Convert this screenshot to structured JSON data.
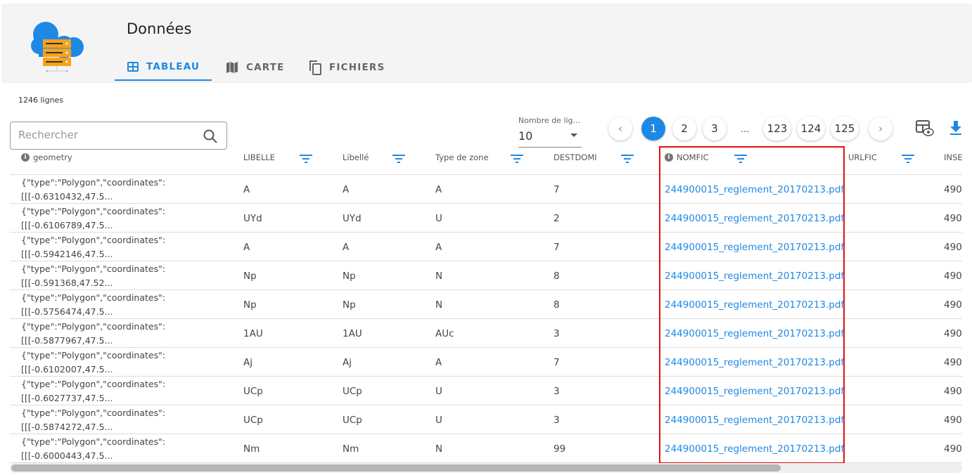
{
  "header": {
    "title": "Données",
    "tabs": [
      {
        "label": "TABLEAU",
        "icon": "table-icon",
        "active": true
      },
      {
        "label": "CARTE",
        "icon": "map-icon"
      },
      {
        "label": "FICHIERS",
        "icon": "copy-files-icon"
      }
    ]
  },
  "row_count": "1246 lignes",
  "search": {
    "placeholder": "Rechercher",
    "value": ""
  },
  "rows_per_page": {
    "label": "Nombre de lig...",
    "value": "10"
  },
  "pagination": {
    "pages": [
      "1",
      "2",
      "3",
      "123",
      "124",
      "125"
    ],
    "ellipsis": "...",
    "current": "1"
  },
  "colors": {
    "accent": "#1e88e5",
    "highlight": "#e01010"
  },
  "columns": [
    {
      "label": "geometry",
      "info": true,
      "filter": false
    },
    {
      "label": "LIBELLE",
      "filter": true
    },
    {
      "label": "Libellé",
      "filter": true
    },
    {
      "label": "Type de zone",
      "filter": true
    },
    {
      "label": "DESTDOMI",
      "filter": true
    },
    {
      "label": "NOMFIC",
      "info": true,
      "filter": true
    },
    {
      "label": "URLFIC",
      "filter": true
    },
    {
      "label": "INSE",
      "filter": false
    }
  ],
  "rows": [
    {
      "geometry": [
        "{\"type\":\"Polygon\",\"coordinates\":",
        "[[[-0.6310432,47.5..."
      ],
      "LIBELLE": "A",
      "Libelle": "A",
      "type": "A",
      "DESTDOMI": "7",
      "NOMFIC": "244900015_reglement_20170213.pdf",
      "URLFIC": "",
      "INSE": "490"
    },
    {
      "geometry": [
        "{\"type\":\"Polygon\",\"coordinates\":",
        "[[[-0.6106789,47.5..."
      ],
      "LIBELLE": "UYd",
      "Libelle": "UYd",
      "type": "U",
      "DESTDOMI": "2",
      "NOMFIC": "244900015_reglement_20170213.pdf",
      "URLFIC": "",
      "INSE": "490"
    },
    {
      "geometry": [
        "{\"type\":\"Polygon\",\"coordinates\":",
        "[[[-0.5942146,47.5..."
      ],
      "LIBELLE": "A",
      "Libelle": "A",
      "type": "A",
      "DESTDOMI": "7",
      "NOMFIC": "244900015_reglement_20170213.pdf",
      "URLFIC": "",
      "INSE": "490"
    },
    {
      "geometry": [
        "{\"type\":\"Polygon\",\"coordinates\":",
        "[[[-0.591368,47.52..."
      ],
      "LIBELLE": "Np",
      "Libelle": "Np",
      "type": "N",
      "DESTDOMI": "8",
      "NOMFIC": "244900015_reglement_20170213.pdf",
      "URLFIC": "",
      "INSE": "490"
    },
    {
      "geometry": [
        "{\"type\":\"Polygon\",\"coordinates\":",
        "[[[-0.5756474,47.5..."
      ],
      "LIBELLE": "Np",
      "Libelle": "Np",
      "type": "N",
      "DESTDOMI": "8",
      "NOMFIC": "244900015_reglement_20170213.pdf",
      "URLFIC": "",
      "INSE": "490"
    },
    {
      "geometry": [
        "{\"type\":\"Polygon\",\"coordinates\":",
        "[[[-0.5877967,47.5..."
      ],
      "LIBELLE": "1AU",
      "Libelle": "1AU",
      "type": "AUc",
      "DESTDOMI": "3",
      "NOMFIC": "244900015_reglement_20170213.pdf",
      "URLFIC": "",
      "INSE": "490"
    },
    {
      "geometry": [
        "{\"type\":\"Polygon\",\"coordinates\":",
        "[[[-0.6102007,47.5..."
      ],
      "LIBELLE": "Aj",
      "Libelle": "Aj",
      "type": "A",
      "DESTDOMI": "7",
      "NOMFIC": "244900015_reglement_20170213.pdf",
      "URLFIC": "",
      "INSE": "490"
    },
    {
      "geometry": [
        "{\"type\":\"Polygon\",\"coordinates\":",
        "[[[-0.6027737,47.5..."
      ],
      "LIBELLE": "UCp",
      "Libelle": "UCp",
      "type": "U",
      "DESTDOMI": "3",
      "NOMFIC": "244900015_reglement_20170213.pdf",
      "URLFIC": "",
      "INSE": "490"
    },
    {
      "geometry": [
        "{\"type\":\"Polygon\",\"coordinates\":",
        "[[[-0.5874272,47.5..."
      ],
      "LIBELLE": "UCp",
      "Libelle": "UCp",
      "type": "U",
      "DESTDOMI": "3",
      "NOMFIC": "244900015_reglement_20170213.pdf",
      "URLFIC": "",
      "INSE": "490"
    },
    {
      "geometry": [
        "{\"type\":\"Polygon\",\"coordinates\":",
        "[[[-0.6000443,47.5..."
      ],
      "LIBELLE": "Nm",
      "Libelle": "Nm",
      "type": "N",
      "DESTDOMI": "99",
      "NOMFIC": "244900015_reglement_20170213.pdf",
      "URLFIC": "",
      "INSE": "490"
    }
  ]
}
